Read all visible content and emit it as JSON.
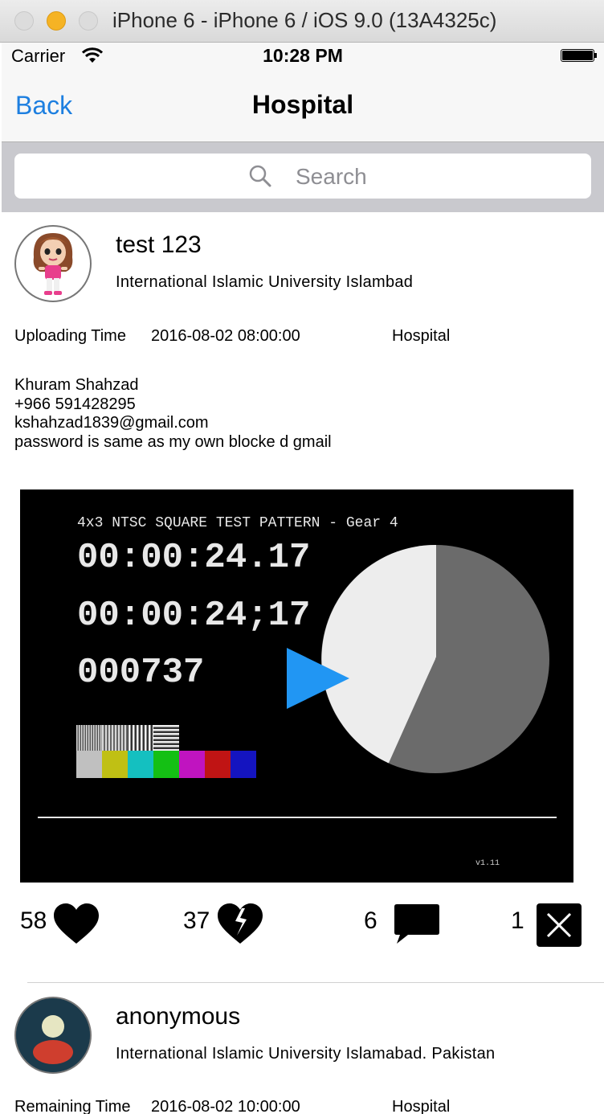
{
  "window": {
    "title": "iPhone 6 - iPhone 6 / iOS 9.0 (13A4325c)"
  },
  "status_bar": {
    "carrier": "Carrier",
    "time": "10:28 PM"
  },
  "nav": {
    "back_label": "Back",
    "title": "Hospital"
  },
  "search": {
    "placeholder": "Search"
  },
  "posts": [
    {
      "user": "test 123",
      "institution": "International Islamic University Islambad",
      "time_label": "Uploading Time",
      "time_value": "2016-08-02 08:00:00",
      "category": "Hospital",
      "description": [
        "Khuram Shahzad",
        "+966 591428295",
        "kshahzad1839@gmail.com",
        "password is same as my own blocke d gmail"
      ],
      "video": {
        "caption": "4x3 NTSC SQUARE TEST PATTERN - Gear 4",
        "timecode_1": "00:00:24.17",
        "timecode_2": "00:00:24;17",
        "frame": "000737",
        "version": "v1.11"
      },
      "likes": "58",
      "dislikes": "37",
      "comments": "6",
      "reports": "1"
    },
    {
      "user": "anonymous",
      "institution": "International Islamic University Islamabad. Pakistan",
      "time_label": "Remaining Time",
      "time_value": "2016-08-02 10:00:00",
      "category": "Hospital"
    }
  ],
  "colors": {
    "accent": "#1d7fe0",
    "play": "#2196f3",
    "avatar_bg": "#1b3a4b"
  }
}
